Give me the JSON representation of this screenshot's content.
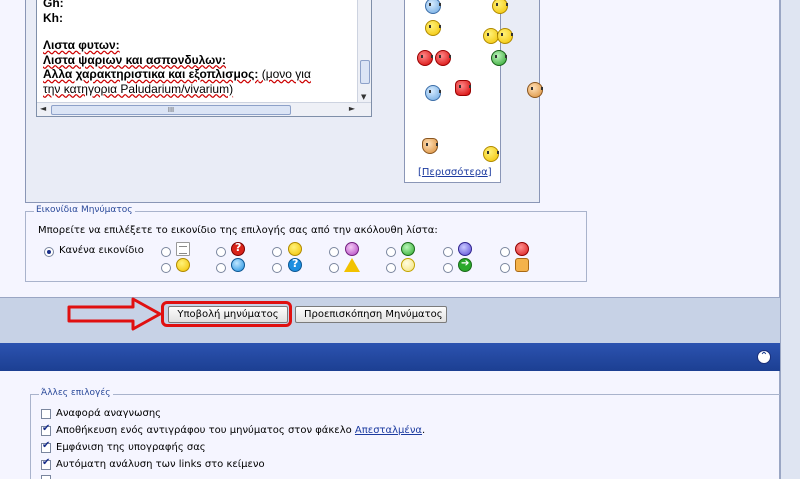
{
  "editor": {
    "lines": [
      {
        "text": "Gh:",
        "bold": true
      },
      {
        "text": "Kh:",
        "bold": true
      },
      {
        "text": "",
        "gap": true
      },
      {
        "text": "Λιστα φυτων:",
        "bold": true
      },
      {
        "text": "Λιστα ψαριων και ασπονδυλων:",
        "bold": true
      },
      {
        "text": "Αλλα χαρακτηριστικα και εξοπλισμος:",
        "bold": true,
        "tail": " (μονο για"
      },
      {
        "text": "την κατηγορια Paludarium/vivarium)",
        "bold": false
      }
    ],
    "hscroll_grip": "III"
  },
  "smilies": {
    "more_link": "[Περισσότερα]",
    "open_bracket": "[",
    "more_text": "Περισσότερα",
    "close_bracket": "]"
  },
  "post_icons": {
    "legend": "Εικονίδια Μηνύματος",
    "description": "Μπορείτε να επιλέξετε το εικονίδιο της επιλογής σας από την ακόλουθη λίστα:",
    "none_label": "Κανένα εικονίδιο",
    "selected": "none",
    "icons_row1": [
      "document-icon",
      "question-icon",
      "smile-icon",
      "tongue-icon",
      "grin-icon",
      "sad-icon",
      "angry-icon"
    ],
    "icons_row2": [
      "wink-icon",
      "cool-icon",
      "question-blue-icon",
      "warning-icon",
      "lightbulb-icon",
      "arrow-icon",
      "thumbs-up-icon"
    ]
  },
  "buttons": {
    "submit": "Υποβολή μηνύματος",
    "preview": "Προεπισκόπηση Μηνύματος"
  },
  "collapse_icon": "⌃",
  "options": {
    "legend": "Άλλες επιλογές",
    "items": [
      {
        "label": "Αναφορά αναγνωσης",
        "checked": false
      },
      {
        "label": "Αποθήκευση ενός αντιγράφου του μηνύματος στον φάκελο ",
        "link": "Απεσταλμένα",
        "after": ".",
        "checked": true
      },
      {
        "label": "Εμφάνιση της υπογραφής σας",
        "checked": true
      },
      {
        "label": "Αυτόματη ανάλυση των links στο κείμενο",
        "checked": true
      }
    ]
  },
  "colors": {
    "highlight": "#e01010",
    "header_bar": "#1c3f92",
    "link": "#1c3ba0"
  }
}
